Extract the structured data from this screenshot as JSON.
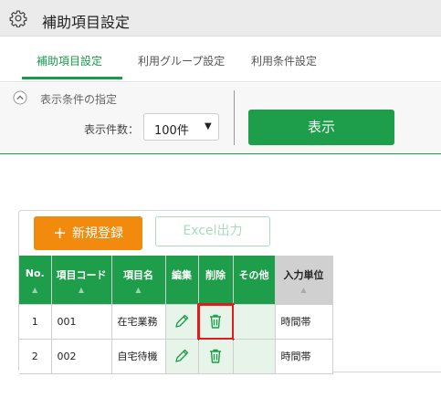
{
  "header": {
    "title": "補助項目設定",
    "icon": "gear-icon"
  },
  "tabs": [
    {
      "label": "補助項目設定",
      "active": true
    },
    {
      "label": "利用グループ設定",
      "active": false
    },
    {
      "label": "利用条件設定",
      "active": false
    }
  ],
  "filter": {
    "section_title": "表示条件の指定",
    "count_label": "表示件数：",
    "count_value": "100件",
    "show_button": "表示"
  },
  "toolbar": {
    "new_button": "新規登録",
    "new_icon": "plus-icon",
    "excel_button": "Excel出力"
  },
  "table": {
    "columns": [
      "No.",
      "項目コード",
      "項目名",
      "編集",
      "削除",
      "その他",
      "入力単位"
    ],
    "sort_glyph": "▲",
    "rows": [
      {
        "no": "1",
        "code": "001",
        "name": "在宅業務",
        "unit": "時間帯",
        "delete_highlighted": true
      },
      {
        "no": "2",
        "code": "002",
        "name": "自宅待機",
        "unit": "時間帯",
        "delete_highlighted": false
      }
    ]
  },
  "colors": {
    "primary_green": "#1e9e4b",
    "accent_orange": "#f18a0d",
    "highlight_red": "#e21b1b",
    "action_cell_bg": "#e7f4ea"
  }
}
